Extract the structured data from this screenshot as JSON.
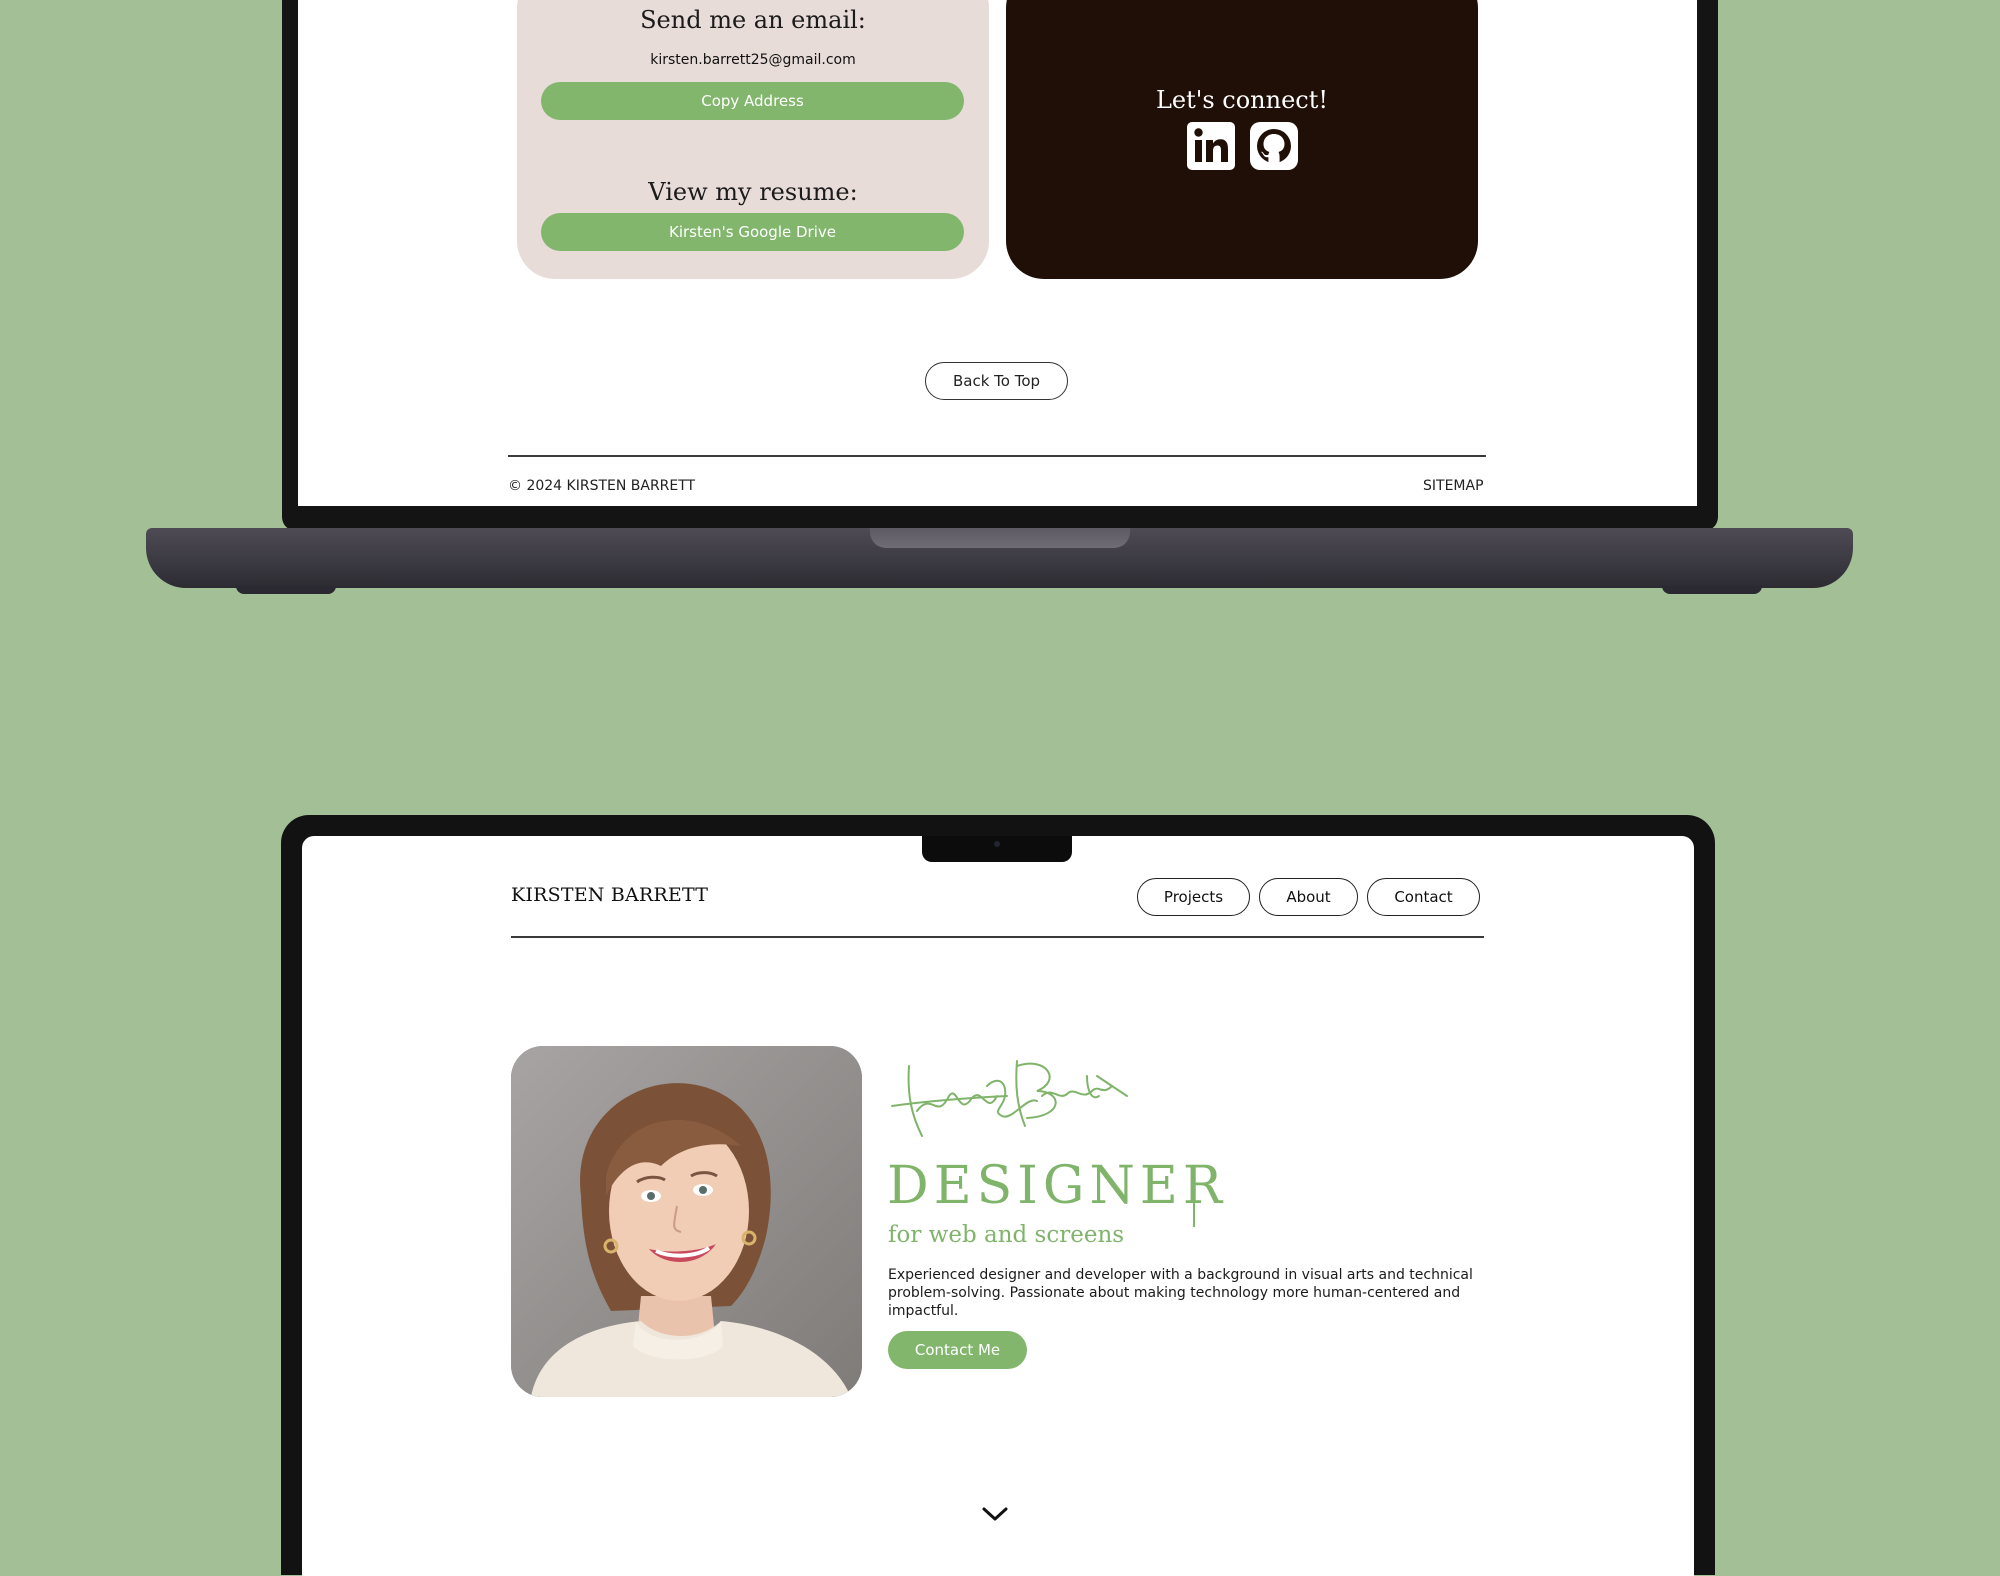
{
  "top_laptop": {
    "email_card": {
      "title": "Send me an email:",
      "email": "kirsten.barrett25@gmail.com",
      "copy_button": "Copy Address",
      "resume_title": "View my resume:",
      "drive_button": "Kirsten's Google Drive"
    },
    "connect_card": {
      "title": "Let's connect!",
      "icons": [
        "linkedin-icon",
        "github-icon"
      ]
    },
    "back_to_top": "Back To Top",
    "footer": {
      "copyright": "© 2024 KIRSTEN BARRETT",
      "sitemap": "SITEMAP"
    }
  },
  "bottom_laptop": {
    "header": {
      "brand": "KIRSTEN BARRETT",
      "nav": [
        "Projects",
        "About",
        "Contact"
      ]
    },
    "hero": {
      "signature_alt": "Kirsten Barrett signature",
      "title": "DESIGNER",
      "subtitle": "for web and screens",
      "bio": "Experienced designer and developer with a background in visual arts and technical problem-solving. Passionate about making technology more human-centered and impactful.",
      "cta": "Contact Me"
    }
  },
  "colors": {
    "background": "#a3bf96",
    "accent_green": "#82b66d",
    "email_card": "#e7dcd8",
    "connect_card": "#1f0f07"
  }
}
